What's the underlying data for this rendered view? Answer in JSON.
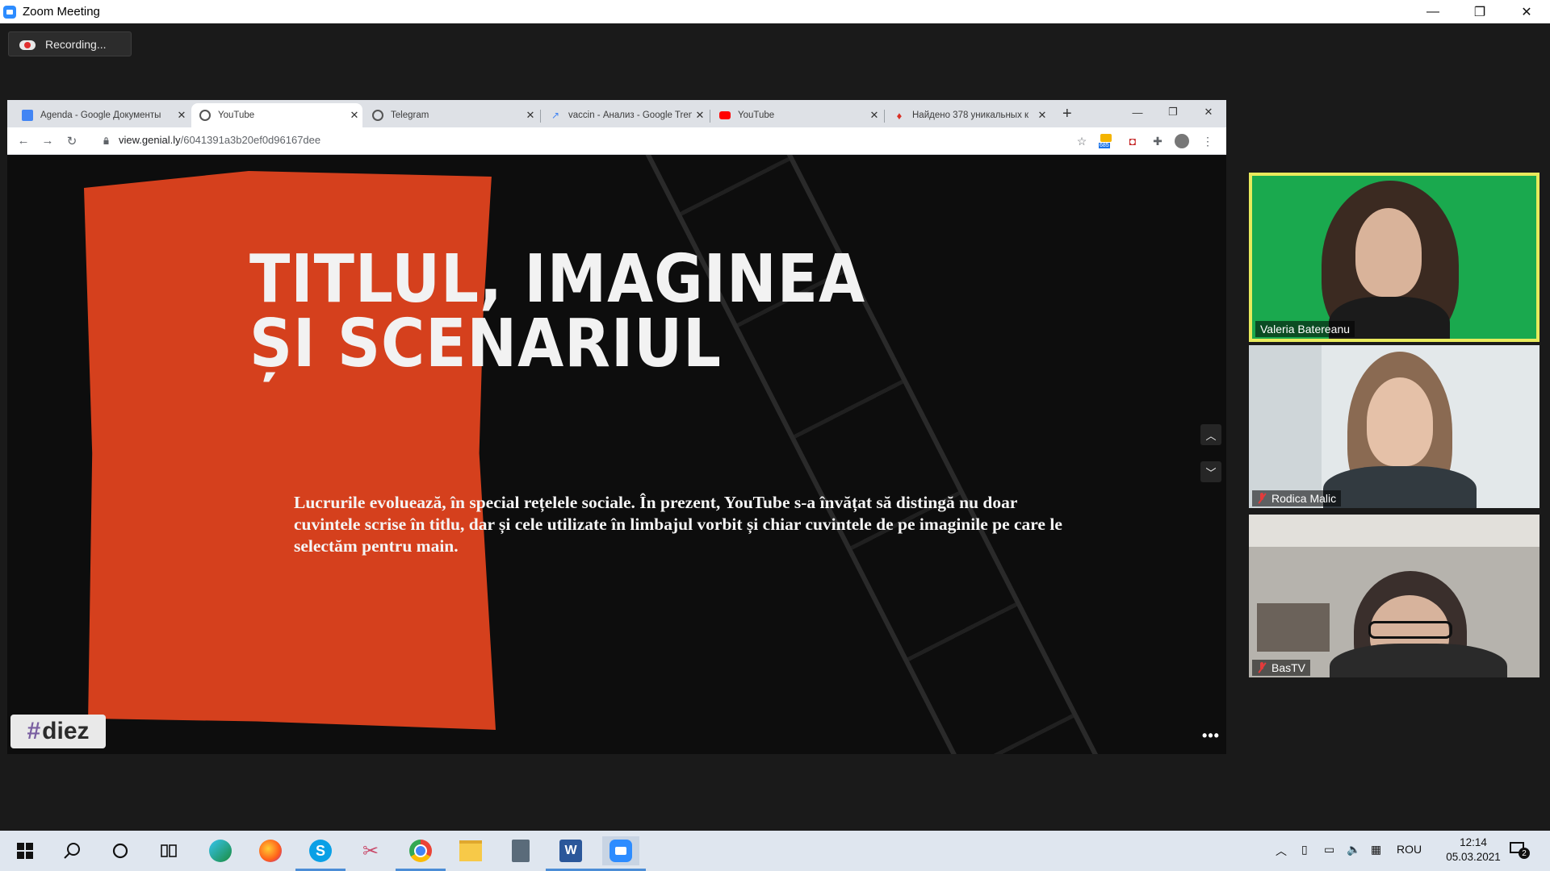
{
  "window": {
    "title": "Zoom Meeting",
    "controls": [
      "—",
      "❐",
      "✕"
    ]
  },
  "recording": {
    "label": "Recording..."
  },
  "browser": {
    "tabs": [
      {
        "label": "Agenda - Google Документы",
        "icon": "docs-icon",
        "color": "#4285f4"
      },
      {
        "label": "YouTube",
        "icon": "chrome-icon",
        "color": "#1a73e8"
      },
      {
        "label": "Telegram",
        "icon": "chrome-icon",
        "color": "#1a73e8"
      },
      {
        "label": "vaccin - Анализ - Google Trends",
        "icon": "trends-icon",
        "color": "#4285f4"
      },
      {
        "label": "YouTube",
        "icon": "youtube-icon",
        "color": "#ff0000"
      },
      {
        "label": "Найдено 378 уникальных к",
        "icon": "flame-icon",
        "color": "#d93025"
      }
    ],
    "new_tab": "+",
    "controls": [
      "—",
      "❐",
      "✕"
    ],
    "url": {
      "host": "view.genial.ly",
      "path": "/6041391a3b20ef0d96167dee"
    },
    "ext_badge": "685"
  },
  "slide": {
    "title_line1": "TITLUL, IMAGINEA",
    "title_line2": "ȘI SCENARIUL",
    "body": "Lucrurile evoluează, în special rețelele sociale. În prezent, YouTube s-a învățat să distingă nu doar cuvintele scrise în titlu, dar și cele utilizate în limbajul vorbit și chiar cuvintele de pe imaginile pe care le selectăm pentru main.",
    "logo": "diez",
    "nav_up": "︿",
    "nav_down": "﹀",
    "more": "•••"
  },
  "participants": [
    {
      "name": "Valeria Batereanu",
      "muted": false,
      "active_speaker": true
    },
    {
      "name": "Rodica Malic",
      "muted": true,
      "active_speaker": false
    },
    {
      "name": "BasTV",
      "muted": true,
      "active_speaker": false
    }
  ],
  "taskbar": {
    "apps": [
      "windows-start-icon",
      "search-icon",
      "cortana-icon",
      "task-view-icon",
      "edge-icon",
      "firefox-icon",
      "skype-icon",
      "snip-icon",
      "chrome-icon",
      "file-explorer-icon",
      "calculator-icon",
      "word-icon",
      "zoom-icon"
    ],
    "lang": "ROU",
    "time": "12:14",
    "date": "05.03.2021",
    "notif_count": "2"
  }
}
